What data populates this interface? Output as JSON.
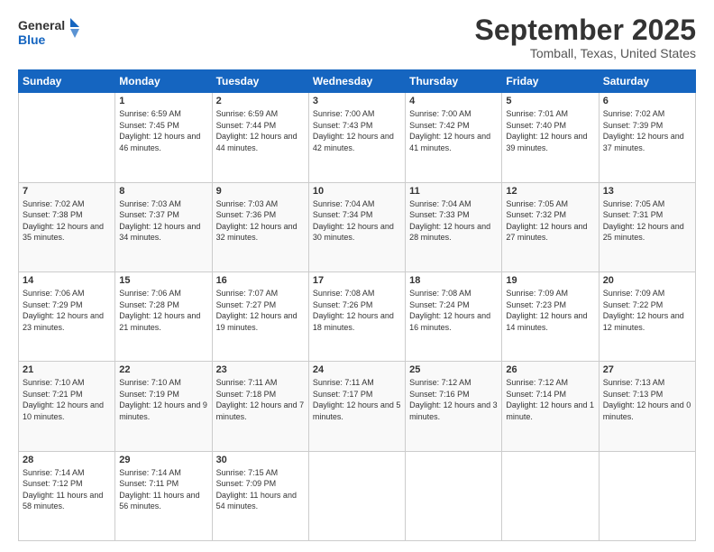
{
  "logo": {
    "line1": "General",
    "line2": "Blue"
  },
  "title": "September 2025",
  "subtitle": "Tomball, Texas, United States",
  "weekdays": [
    "Sunday",
    "Monday",
    "Tuesday",
    "Wednesday",
    "Thursday",
    "Friday",
    "Saturday"
  ],
  "weeks": [
    [
      {
        "day": "",
        "sunrise": "",
        "sunset": "",
        "daylight": ""
      },
      {
        "day": "1",
        "sunrise": "Sunrise: 6:59 AM",
        "sunset": "Sunset: 7:45 PM",
        "daylight": "Daylight: 12 hours and 46 minutes."
      },
      {
        "day": "2",
        "sunrise": "Sunrise: 6:59 AM",
        "sunset": "Sunset: 7:44 PM",
        "daylight": "Daylight: 12 hours and 44 minutes."
      },
      {
        "day": "3",
        "sunrise": "Sunrise: 7:00 AM",
        "sunset": "Sunset: 7:43 PM",
        "daylight": "Daylight: 12 hours and 42 minutes."
      },
      {
        "day": "4",
        "sunrise": "Sunrise: 7:00 AM",
        "sunset": "Sunset: 7:42 PM",
        "daylight": "Daylight: 12 hours and 41 minutes."
      },
      {
        "day": "5",
        "sunrise": "Sunrise: 7:01 AM",
        "sunset": "Sunset: 7:40 PM",
        "daylight": "Daylight: 12 hours and 39 minutes."
      },
      {
        "day": "6",
        "sunrise": "Sunrise: 7:02 AM",
        "sunset": "Sunset: 7:39 PM",
        "daylight": "Daylight: 12 hours and 37 minutes."
      }
    ],
    [
      {
        "day": "7",
        "sunrise": "Sunrise: 7:02 AM",
        "sunset": "Sunset: 7:38 PM",
        "daylight": "Daylight: 12 hours and 35 minutes."
      },
      {
        "day": "8",
        "sunrise": "Sunrise: 7:03 AM",
        "sunset": "Sunset: 7:37 PM",
        "daylight": "Daylight: 12 hours and 34 minutes."
      },
      {
        "day": "9",
        "sunrise": "Sunrise: 7:03 AM",
        "sunset": "Sunset: 7:36 PM",
        "daylight": "Daylight: 12 hours and 32 minutes."
      },
      {
        "day": "10",
        "sunrise": "Sunrise: 7:04 AM",
        "sunset": "Sunset: 7:34 PM",
        "daylight": "Daylight: 12 hours and 30 minutes."
      },
      {
        "day": "11",
        "sunrise": "Sunrise: 7:04 AM",
        "sunset": "Sunset: 7:33 PM",
        "daylight": "Daylight: 12 hours and 28 minutes."
      },
      {
        "day": "12",
        "sunrise": "Sunrise: 7:05 AM",
        "sunset": "Sunset: 7:32 PM",
        "daylight": "Daylight: 12 hours and 27 minutes."
      },
      {
        "day": "13",
        "sunrise": "Sunrise: 7:05 AM",
        "sunset": "Sunset: 7:31 PM",
        "daylight": "Daylight: 12 hours and 25 minutes."
      }
    ],
    [
      {
        "day": "14",
        "sunrise": "Sunrise: 7:06 AM",
        "sunset": "Sunset: 7:29 PM",
        "daylight": "Daylight: 12 hours and 23 minutes."
      },
      {
        "day": "15",
        "sunrise": "Sunrise: 7:06 AM",
        "sunset": "Sunset: 7:28 PM",
        "daylight": "Daylight: 12 hours and 21 minutes."
      },
      {
        "day": "16",
        "sunrise": "Sunrise: 7:07 AM",
        "sunset": "Sunset: 7:27 PM",
        "daylight": "Daylight: 12 hours and 19 minutes."
      },
      {
        "day": "17",
        "sunrise": "Sunrise: 7:08 AM",
        "sunset": "Sunset: 7:26 PM",
        "daylight": "Daylight: 12 hours and 18 minutes."
      },
      {
        "day": "18",
        "sunrise": "Sunrise: 7:08 AM",
        "sunset": "Sunset: 7:24 PM",
        "daylight": "Daylight: 12 hours and 16 minutes."
      },
      {
        "day": "19",
        "sunrise": "Sunrise: 7:09 AM",
        "sunset": "Sunset: 7:23 PM",
        "daylight": "Daylight: 12 hours and 14 minutes."
      },
      {
        "day": "20",
        "sunrise": "Sunrise: 7:09 AM",
        "sunset": "Sunset: 7:22 PM",
        "daylight": "Daylight: 12 hours and 12 minutes."
      }
    ],
    [
      {
        "day": "21",
        "sunrise": "Sunrise: 7:10 AM",
        "sunset": "Sunset: 7:21 PM",
        "daylight": "Daylight: 12 hours and 10 minutes."
      },
      {
        "day": "22",
        "sunrise": "Sunrise: 7:10 AM",
        "sunset": "Sunset: 7:19 PM",
        "daylight": "Daylight: 12 hours and 9 minutes."
      },
      {
        "day": "23",
        "sunrise": "Sunrise: 7:11 AM",
        "sunset": "Sunset: 7:18 PM",
        "daylight": "Daylight: 12 hours and 7 minutes."
      },
      {
        "day": "24",
        "sunrise": "Sunrise: 7:11 AM",
        "sunset": "Sunset: 7:17 PM",
        "daylight": "Daylight: 12 hours and 5 minutes."
      },
      {
        "day": "25",
        "sunrise": "Sunrise: 7:12 AM",
        "sunset": "Sunset: 7:16 PM",
        "daylight": "Daylight: 12 hours and 3 minutes."
      },
      {
        "day": "26",
        "sunrise": "Sunrise: 7:12 AM",
        "sunset": "Sunset: 7:14 PM",
        "daylight": "Daylight: 12 hours and 1 minute."
      },
      {
        "day": "27",
        "sunrise": "Sunrise: 7:13 AM",
        "sunset": "Sunset: 7:13 PM",
        "daylight": "Daylight: 12 hours and 0 minutes."
      }
    ],
    [
      {
        "day": "28",
        "sunrise": "Sunrise: 7:14 AM",
        "sunset": "Sunset: 7:12 PM",
        "daylight": "Daylight: 11 hours and 58 minutes."
      },
      {
        "day": "29",
        "sunrise": "Sunrise: 7:14 AM",
        "sunset": "Sunset: 7:11 PM",
        "daylight": "Daylight: 11 hours and 56 minutes."
      },
      {
        "day": "30",
        "sunrise": "Sunrise: 7:15 AM",
        "sunset": "Sunset: 7:09 PM",
        "daylight": "Daylight: 11 hours and 54 minutes."
      },
      {
        "day": "",
        "sunrise": "",
        "sunset": "",
        "daylight": ""
      },
      {
        "day": "",
        "sunrise": "",
        "sunset": "",
        "daylight": ""
      },
      {
        "day": "",
        "sunrise": "",
        "sunset": "",
        "daylight": ""
      },
      {
        "day": "",
        "sunrise": "",
        "sunset": "",
        "daylight": ""
      }
    ]
  ]
}
